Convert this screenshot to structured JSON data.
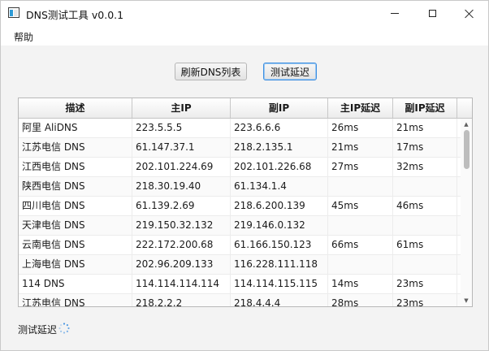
{
  "window": {
    "title": "DNS测试工具 v0.0.1"
  },
  "menu": {
    "items": [
      "帮助"
    ]
  },
  "toolbar": {
    "refresh_label": "刷新DNS列表",
    "test_label": "测试延迟"
  },
  "table": {
    "columns": [
      "描述",
      "主IP",
      "副IP",
      "主IP延迟",
      "副IP延迟"
    ],
    "rows": [
      [
        "阿里 AliDNS",
        "223.5.5.5",
        "223.6.6.6",
        "26ms",
        "21ms"
      ],
      [
        "江苏电信 DNS",
        "61.147.37.1",
        "218.2.135.1",
        "21ms",
        "17ms"
      ],
      [
        "江西电信 DNS",
        "202.101.224.69",
        "202.101.226.68",
        "27ms",
        "32ms"
      ],
      [
        "陕西电信 DNS",
        "218.30.19.40",
        "61.134.1.4",
        "",
        ""
      ],
      [
        "四川电信 DNS",
        "61.139.2.69",
        "218.6.200.139",
        "45ms",
        "46ms"
      ],
      [
        "天津电信 DNS",
        "219.150.32.132",
        "219.146.0.132",
        "",
        ""
      ],
      [
        "云南电信 DNS",
        "222.172.200.68",
        "61.166.150.123",
        "66ms",
        "61ms"
      ],
      [
        "上海电信 DNS",
        "202.96.209.133",
        "116.228.111.118",
        "",
        ""
      ],
      [
        "114 DNS",
        "114.114.114.114",
        "114.114.115.115",
        "14ms",
        "23ms"
      ],
      [
        "江苏电信 DNS",
        "218.2.2.2",
        "218.4.4.4",
        "28ms",
        "23ms"
      ]
    ]
  },
  "status": {
    "text": "测试延迟"
  },
  "colors": {
    "accent": "#3c8ee0",
    "spinner": "#3c8ee0"
  }
}
